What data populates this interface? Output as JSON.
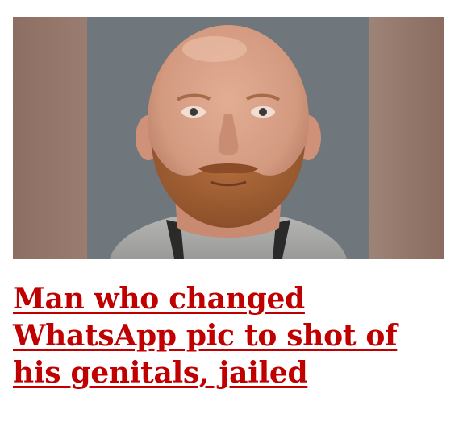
{
  "article": {
    "headline": "Man who changed WhatsApp pic to shot of his genitals, jailed",
    "headline_color": "#c00000",
    "image": {
      "subject": "custody photo of a bald man with a ginger beard against a grey background"
    }
  }
}
